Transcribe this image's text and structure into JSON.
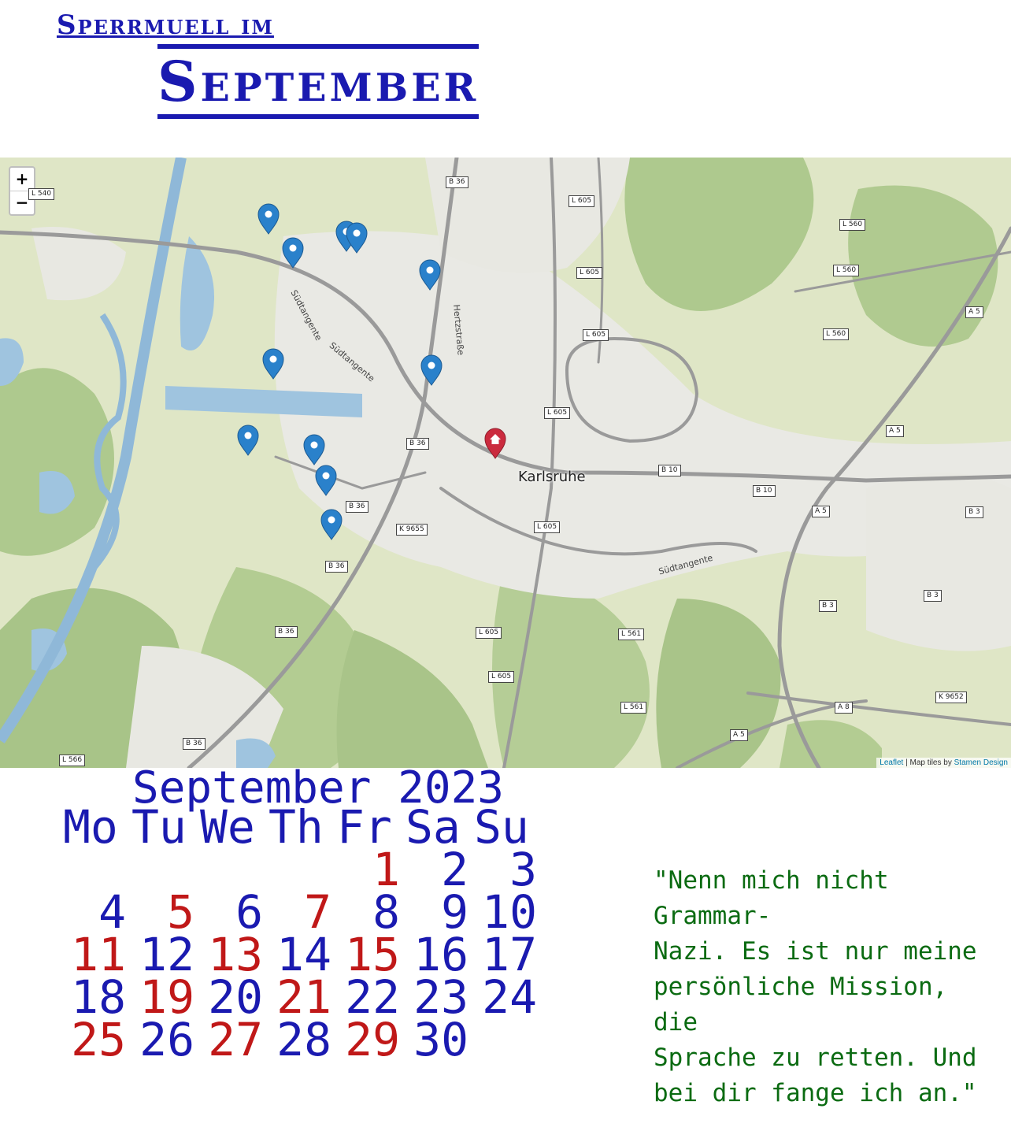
{
  "header": {
    "line1": "Sperrmuell im",
    "line2": "September"
  },
  "map": {
    "zoom_in": "+",
    "zoom_out": "−",
    "city_label": "Karlsruhe",
    "street_labels": [
      "Südtangente",
      "Südtangente",
      "Hertzstraße",
      "Südtangente"
    ],
    "road_labels": [
      "L 540",
      "B 36",
      "L 605",
      "L 560",
      "L 605",
      "L 560",
      "L 605",
      "A 5",
      "L 560",
      "L 605",
      "A 5",
      "B 36",
      "B 10",
      "B 10",
      "A 5",
      "B 3",
      "B 36",
      "K 9655",
      "L 605",
      "B 36",
      "B 36",
      "L 605",
      "L 561",
      "B 3",
      "B 3",
      "L 605",
      "L 561",
      "A 8",
      "K 9652",
      "A 5",
      "B 36",
      "L 566"
    ],
    "attribution": {
      "leaflet": "Leaflet",
      "sep": " | Map tiles by ",
      "provider": "Stamen Design"
    },
    "marker_colors": {
      "blue": "#2a81cb",
      "red": "#cb2b3e"
    }
  },
  "calendar": {
    "title": "September 2023",
    "weekdays": [
      "Mo",
      "Tu",
      "We",
      "Th",
      "Fr",
      "Sa",
      "Su"
    ],
    "weeks": [
      [
        null,
        null,
        null,
        null,
        {
          "d": "1",
          "c": "red"
        },
        {
          "d": "2",
          "c": "blue"
        },
        {
          "d": "3",
          "c": "blue"
        }
      ],
      [
        {
          "d": "4",
          "c": "blue"
        },
        {
          "d": "5",
          "c": "red"
        },
        {
          "d": "6",
          "c": "blue"
        },
        {
          "d": "7",
          "c": "red"
        },
        {
          "d": "8",
          "c": "blue"
        },
        {
          "d": "9",
          "c": "blue"
        },
        {
          "d": "10",
          "c": "blue"
        }
      ],
      [
        {
          "d": "11",
          "c": "red"
        },
        {
          "d": "12",
          "c": "blue"
        },
        {
          "d": "13",
          "c": "red"
        },
        {
          "d": "14",
          "c": "blue"
        },
        {
          "d": "15",
          "c": "red"
        },
        {
          "d": "16",
          "c": "blue"
        },
        {
          "d": "17",
          "c": "blue"
        }
      ],
      [
        {
          "d": "18",
          "c": "blue"
        },
        {
          "d": "19",
          "c": "red"
        },
        {
          "d": "20",
          "c": "blue"
        },
        {
          "d": "21",
          "c": "red"
        },
        {
          "d": "22",
          "c": "blue"
        },
        {
          "d": "23",
          "c": "blue"
        },
        {
          "d": "24",
          "c": "blue"
        }
      ],
      [
        {
          "d": "25",
          "c": "red"
        },
        {
          "d": "26",
          "c": "blue"
        },
        {
          "d": "27",
          "c": "red"
        },
        {
          "d": "28",
          "c": "blue"
        },
        {
          "d": "29",
          "c": "red"
        },
        {
          "d": "30",
          "c": "blue"
        },
        null
      ]
    ]
  },
  "quote": {
    "lines": [
      "\"Nenn mich nicht Grammar-",
      "Nazi. Es ist nur meine",
      "persönliche Mission, die",
      "Sprache zu retten. Und",
      "bei dir fange ich an.\""
    ]
  }
}
